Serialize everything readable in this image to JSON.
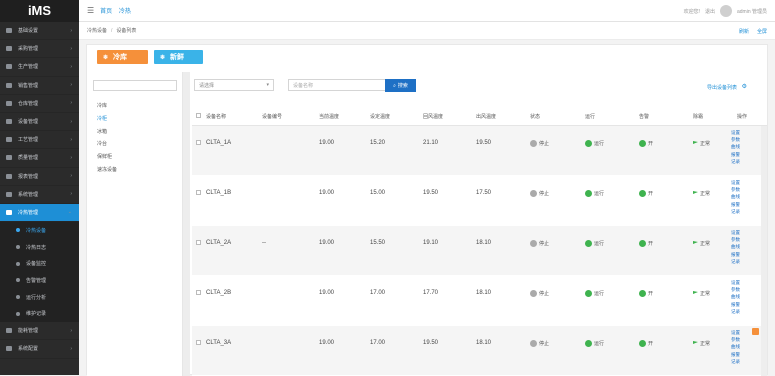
{
  "app": {
    "logo": "iMS"
  },
  "sidebar": {
    "items": [
      {
        "label": "基础设置",
        "active": false
      },
      {
        "label": "采购管理",
        "active": false
      },
      {
        "label": "生产管理",
        "active": false
      },
      {
        "label": "销售管理",
        "active": false
      },
      {
        "label": "仓库管理",
        "active": false
      },
      {
        "label": "设备管理",
        "active": false
      },
      {
        "label": "工艺管理",
        "active": false
      },
      {
        "label": "质量管理",
        "active": false
      },
      {
        "label": "报表管理",
        "active": false
      },
      {
        "label": "系统管理",
        "active": false
      },
      {
        "label": "冷热管理",
        "active": true
      }
    ],
    "submenu": [
      {
        "label": "冷热设备",
        "current": true
      },
      {
        "label": "冷热日志"
      },
      {
        "label": "设备监控"
      },
      {
        "label": "告警管理"
      },
      {
        "label": "运行分析"
      },
      {
        "label": "维护记录"
      }
    ],
    "bottom": [
      {
        "label": "能耗管理"
      },
      {
        "label": "系统配置"
      }
    ]
  },
  "topbar": {
    "crumbs": [
      "首页",
      "冷热"
    ],
    "right_text": [
      "欢迎您!",
      "退出"
    ],
    "user": "admin 管理员"
  },
  "subbar": {
    "path": [
      "冷热设备",
      "设备列表"
    ],
    "actions": [
      "刷新",
      "全屏"
    ]
  },
  "buttons": {
    "cold": "冷库",
    "fresh": "新鲜"
  },
  "tree": {
    "search_placeholder": "",
    "items": [
      "冷库",
      "冷柜",
      "冰箱",
      "冷台",
      "保鲜柜",
      "速冻设备"
    ],
    "selected_index": 1
  },
  "filters": {
    "select_value": "请选择",
    "input_placeholder": "设备名称",
    "search_label": "搜索",
    "right_link": "导出设备列表"
  },
  "table": {
    "headers": [
      "设备名称",
      "设备编号",
      "当前温度",
      "设定温度",
      "回风温度",
      "出风温度",
      "状态",
      "运行",
      "告警",
      "除霜",
      "操作"
    ],
    "rows": [
      {
        "name": "CLTA_1A",
        "code": "",
        "cur": "19.00",
        "set": "15.20",
        "ret": "21.10",
        "out": "19.50",
        "status": "停止",
        "run": "运行",
        "alarm": "开",
        "defrost": "正常"
      },
      {
        "name": "CLTA_1B",
        "code": "",
        "cur": "19.00",
        "set": "15.00",
        "ret": "19.50",
        "out": "17.50",
        "status": "停止",
        "run": "运行",
        "alarm": "开",
        "defrost": "正常"
      },
      {
        "name": "CLTA_2A",
        "code": "--",
        "cur": "19.00",
        "set": "15.50",
        "ret": "19.10",
        "out": "18.10",
        "status": "停止",
        "run": "运行",
        "alarm": "开",
        "defrost": "正常"
      },
      {
        "name": "CLTA_2B",
        "code": "",
        "cur": "19.00",
        "set": "17.00",
        "ret": "17.70",
        "out": "18.10",
        "status": "停止",
        "run": "运行",
        "alarm": "开",
        "defrost": "正常"
      },
      {
        "name": "CLTA_3A",
        "code": "",
        "cur": "19.00",
        "set": "17.00",
        "ret": "19.50",
        "out": "18.10",
        "status": "停止",
        "run": "运行",
        "alarm": "开",
        "defrost": "正常"
      }
    ],
    "ops": [
      "设置",
      "参数",
      "曲线",
      "报警",
      "记录"
    ]
  }
}
